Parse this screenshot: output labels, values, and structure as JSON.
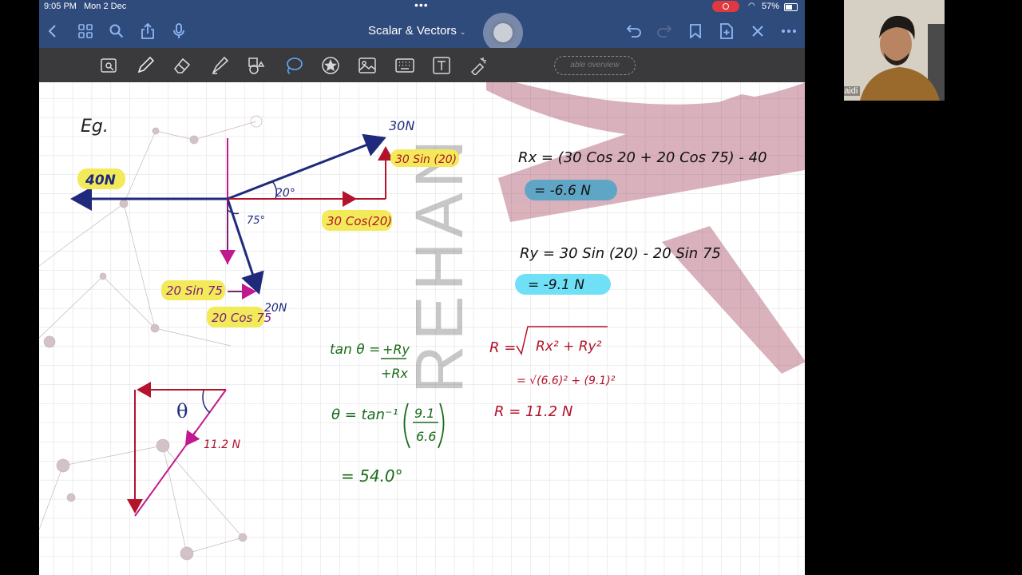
{
  "status": {
    "time": "9:05 PM",
    "date": "Mon 2 Dec",
    "battery": "57%"
  },
  "header": {
    "title": "Scalar & Vectors",
    "icons": [
      "back-icon",
      "grid-icon",
      "search-icon",
      "share-icon",
      "mic-icon",
      "undo-icon",
      "redo-icon",
      "bookmark-icon",
      "add-page-icon",
      "close-icon",
      "more-icon"
    ]
  },
  "toolbar": {
    "tools": [
      "lasso-zoom-icon",
      "pen-icon",
      "eraser-icon",
      "highlighter-icon",
      "shapes-icon",
      "lasso-icon",
      "sticker-icon",
      "image-icon",
      "keyboard-icon",
      "text-icon",
      "laser-icon"
    ],
    "pill_text": "able overview"
  },
  "notes": {
    "example_label": "Eg.",
    "watermark": "REHAN",
    "force_40": "40N",
    "force_30": "30N",
    "force_20": "20N",
    "angle_20": "20°",
    "angle_75": "75°",
    "comp_30sin": "30 Sin (20)",
    "comp_30cos": "30 Cos(20)",
    "comp_20sin": "20 Sin 75",
    "comp_20cos": "20 Cos 75",
    "rx_eq": "Rx = (30 Cos 20 + 20 Cos 75) - 40",
    "rx_val": "= -6.6 N",
    "ry_eq": "Ry = 30 Sin (20) - 20 Sin 75",
    "ry_val": "= -9.1 N",
    "tan_lhs": "tan θ =",
    "tan_num": "+Ry",
    "tan_den": "+Rx",
    "theta_lhs": "θ = tan⁻¹",
    "theta_num": "9.1",
    "theta_den": "6.6",
    "theta_val": "= 54.0°",
    "r_lhs": "R =",
    "r_sqrt1": "Rx² + Ry²",
    "r_sqrt2": "= √(6.6)² + (9.1)²",
    "r_val": "R = 11.2 N",
    "tri_theta": "θ",
    "tri_force": "11.2 N"
  },
  "webcam": {
    "name": "Rehan Zaidi"
  }
}
